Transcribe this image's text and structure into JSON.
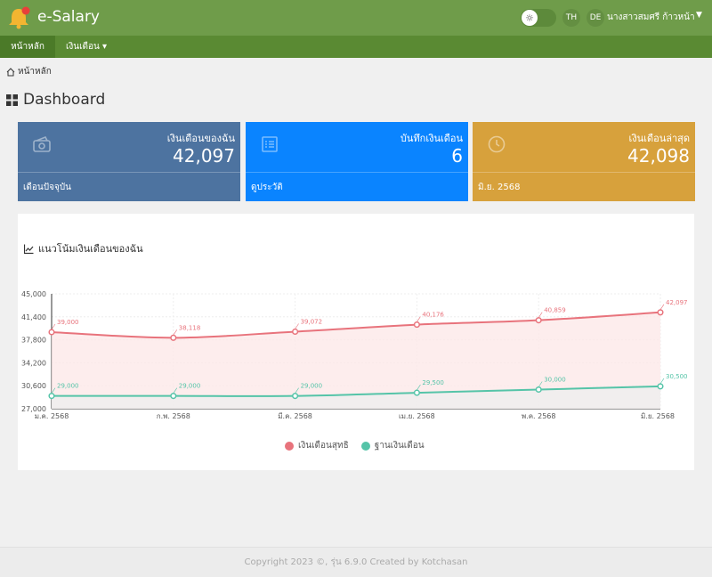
{
  "header": {
    "app_title": "e-Salary",
    "lang_th": "TH",
    "lang_de": "DE",
    "user_name": "นางสาวสมศรี ก้าวหน้า",
    "user_caret": "▼",
    "theme_icon": "sun-icon"
  },
  "nav": {
    "home": "หน้าหลัก",
    "salary": "เงินเดือน ▾"
  },
  "breadcrumb": {
    "home": "หน้าหลัก"
  },
  "page": {
    "title": "Dashboard"
  },
  "cards": [
    {
      "label": "เงินเดือนของฉัน",
      "value": "42,097",
      "footer": "เดือนปัจจุบัน",
      "icon": "money-icon",
      "color": "#4d73a0"
    },
    {
      "label": "บันทึกเงินเดือน",
      "value": "6",
      "footer": "ดูประวัติ",
      "icon": "list-icon",
      "color": "#0a84ff"
    },
    {
      "label": "เงินเดือนล่าสุด",
      "value": "42,098",
      "footer": "มิ.ย. 2568",
      "icon": "clock-icon",
      "color": "#d7a13c"
    }
  ],
  "chart_title": "แนวโน้มเงินเดือนของฉัน",
  "chart_data": {
    "type": "line",
    "categories": [
      "ม.ค. 2568",
      "ก.พ. 2568",
      "มี.ค. 2568",
      "เม.ย. 2568",
      "พ.ค. 2568",
      "มิ.ย. 2568"
    ],
    "y_ticks": [
      "27,000",
      "30,600",
      "34,200",
      "37,800",
      "41,400",
      "45,000"
    ],
    "ylim": [
      27000,
      45000
    ],
    "grid": true,
    "legend_position": "bottom",
    "series": [
      {
        "name": "เงินเดือนสุทธิ",
        "values": [
          39000,
          38118,
          39072,
          40176,
          40859,
          42097
        ],
        "labels": [
          "39,000",
          "38,118",
          "39,072",
          "40,176",
          "40,859",
          "42,097"
        ],
        "color": "#e8737c",
        "fill": "#fde8e9"
      },
      {
        "name": "ฐานเงินเดือน",
        "values": [
          29000,
          29000,
          29000,
          29500,
          30000,
          30500
        ],
        "labels": [
          "29,000",
          "29,000",
          "29,000",
          "29,500",
          "30,000",
          "30,500"
        ],
        "color": "#55c4a8",
        "fill": "#eeeeee"
      }
    ]
  },
  "footer": {
    "text": "Copyright 2023 ©, รุ่น 6.9.0 Created by Kotchasan"
  }
}
